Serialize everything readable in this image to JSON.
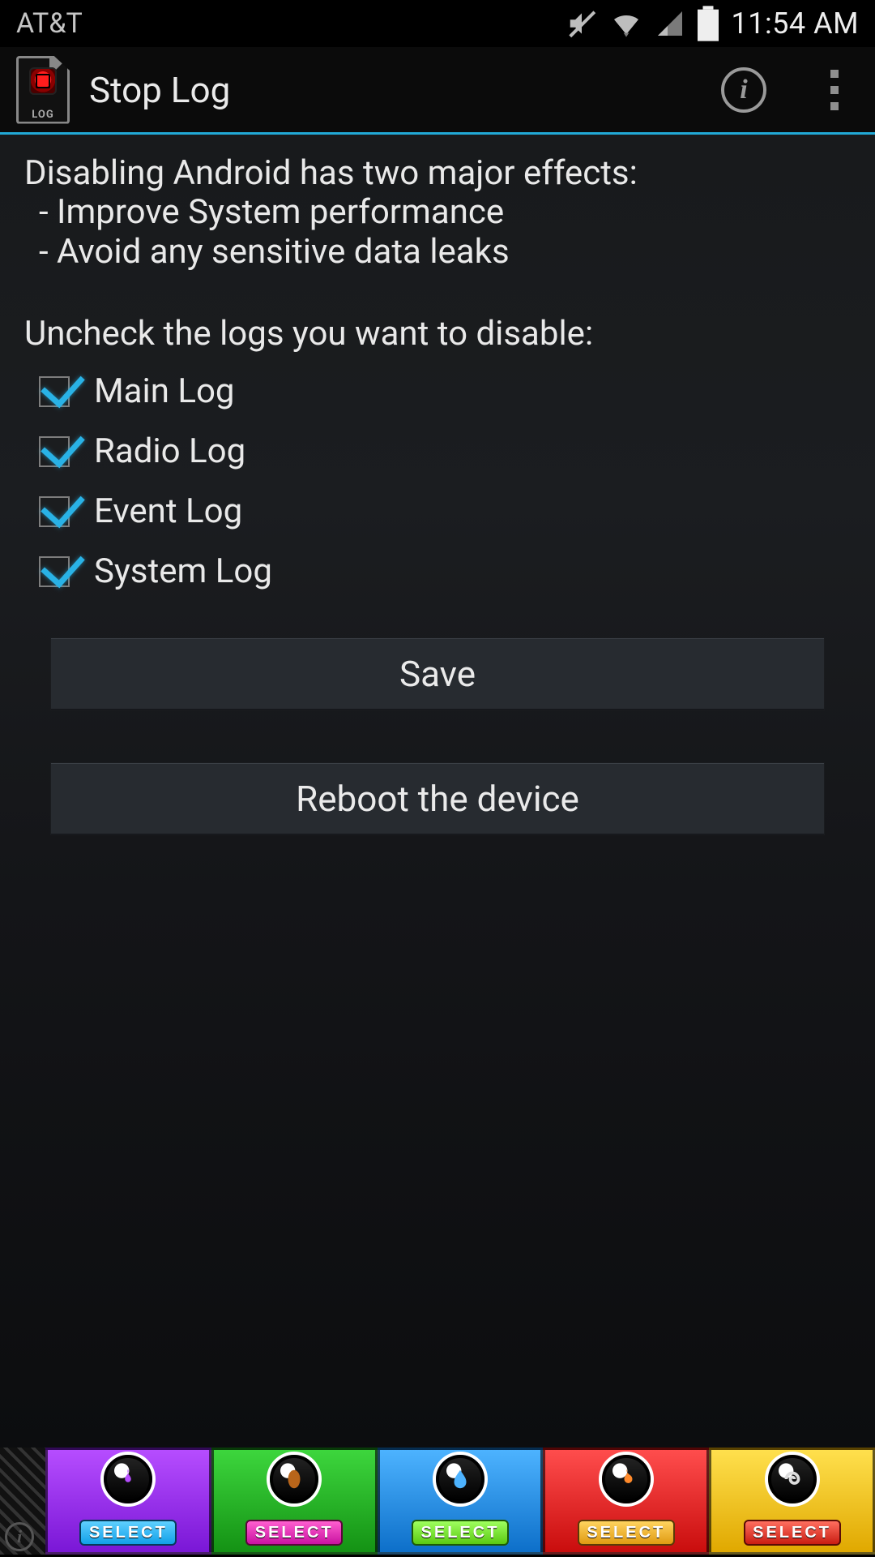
{
  "status_bar": {
    "carrier": "AT&T",
    "clock": "11:54 AM",
    "icons": [
      "mute-icon",
      "wifi-icon",
      "signal-icon",
      "battery-icon"
    ]
  },
  "action_bar": {
    "title": "Stop Log"
  },
  "content": {
    "headline": "Disabling Android has two major effects:",
    "bullet1": " - Improve System performance",
    "bullet2": " - Avoid any sensitive data leaks",
    "instruction": "Uncheck the logs you want to disable:",
    "checks": [
      {
        "label": "Main Log",
        "checked": true
      },
      {
        "label": "Radio Log",
        "checked": true
      },
      {
        "label": "Event Log",
        "checked": true
      },
      {
        "label": "System Log",
        "checked": true
      }
    ],
    "save_label": "Save",
    "reboot_label": "Reboot the device"
  },
  "ad": {
    "select_label": "SELECT",
    "tiles": [
      "purple",
      "green",
      "blue",
      "red",
      "yellow"
    ]
  }
}
